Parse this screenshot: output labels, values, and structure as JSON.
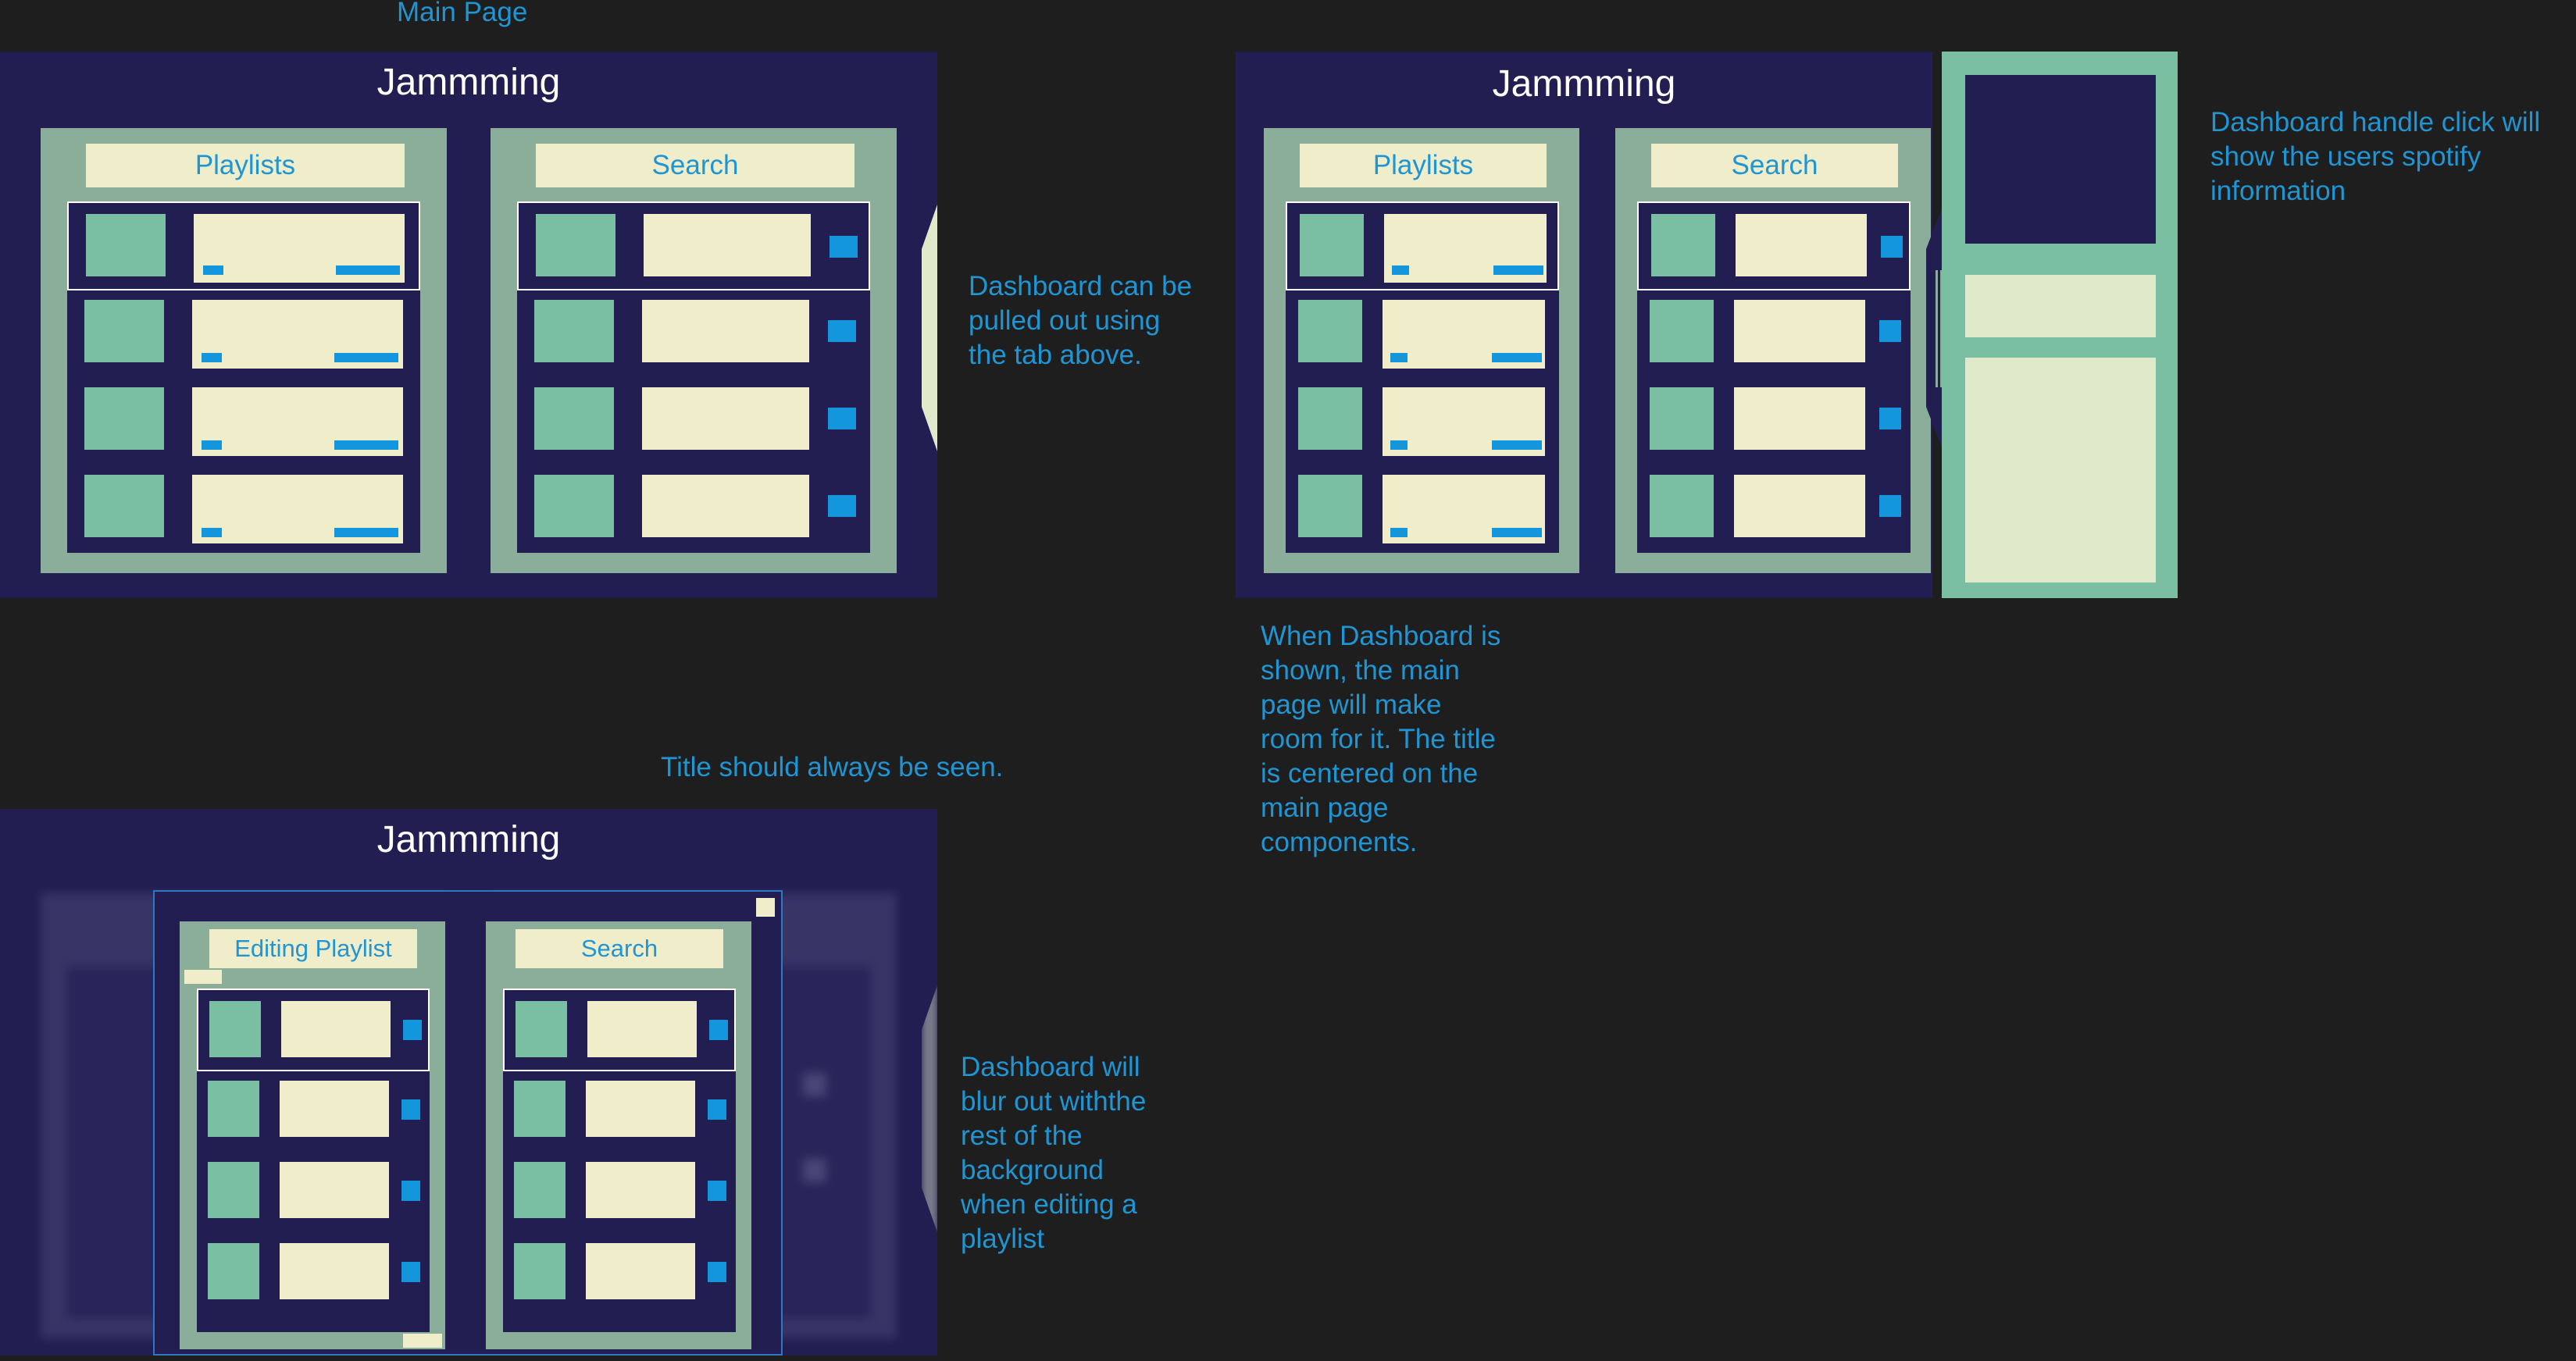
{
  "labels": {
    "main_page": "Main Page",
    "title_note": "Title should always be seen."
  },
  "app": {
    "title": "Jammming"
  },
  "panels": {
    "playlists": "Playlists",
    "search": "Search",
    "editing_playlist": "Editing Playlist"
  },
  "notes": {
    "dashboard_tab": "Dashboard can be\npulled out using\nthe tab above.",
    "dashboard_handle": "Dashboard  handle click will\nshow the users spotify\ninformation",
    "dashboard_shown": "When Dashboard is\nshown, the main\npage will make\nroom for it. The title\nis centered on the\nmain page\ncomponents.",
    "dashboard_blur": "Dashboard will\nblur out withthe\nrest of the\nbackground\nwhen editing a\nplaylist"
  },
  "colors": {
    "canvas": "#1e1e1e",
    "frame": "#221e52",
    "panel": "#8aae99",
    "thumb": "#7bbfa2",
    "card": "#efedca",
    "accent": "#1496dc",
    "annotation": "#1f95d4"
  }
}
